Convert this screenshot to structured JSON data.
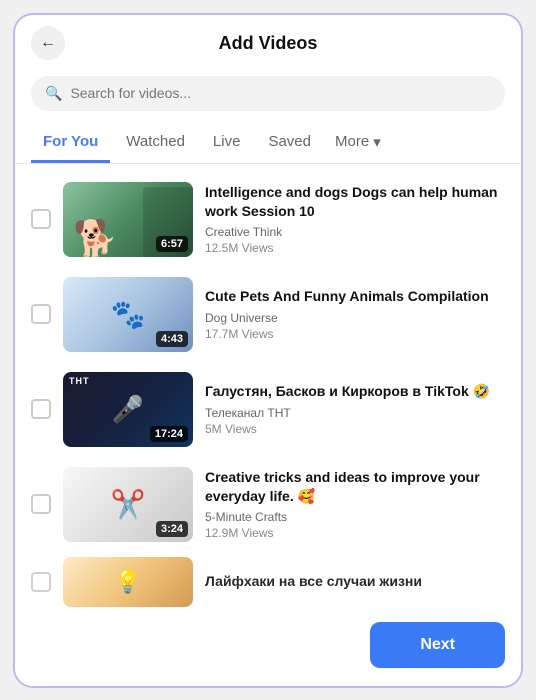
{
  "header": {
    "title": "Add Videos",
    "back_label": "←"
  },
  "search": {
    "placeholder": "Search for videos..."
  },
  "tabs": [
    {
      "id": "for-you",
      "label": "For You",
      "active": true
    },
    {
      "id": "watched",
      "label": "Watched",
      "active": false
    },
    {
      "id": "live",
      "label": "Live",
      "active": false
    },
    {
      "id": "saved",
      "label": "Saved",
      "active": false
    },
    {
      "id": "more",
      "label": "More",
      "active": false
    }
  ],
  "videos": [
    {
      "id": 1,
      "title": "Intelligence and dogs Dogs can help human work Session 10",
      "channel": "Creative Think",
      "views": "12.5M Views",
      "duration": "6:57",
      "thumb_class": "thumb-1",
      "emoji": "🐕"
    },
    {
      "id": 2,
      "title": "Cute Pets And Funny Animals Compilation",
      "channel": "Dog Universe",
      "views": "17.7M Views",
      "duration": "4:43",
      "thumb_class": "thumb-2",
      "emoji": "🐾"
    },
    {
      "id": 3,
      "title": "Галустян, Басков и Киркоров в TikTok 🤣",
      "channel": "Телеканал ТНТ",
      "views": "5M Views",
      "duration": "17:24",
      "thumb_class": "thumb-3",
      "emoji": "🎤"
    },
    {
      "id": 4,
      "title": "Creative tricks and ideas to improve your everyday life. 🥰",
      "channel": "5-Minute Crafts",
      "views": "12.9M Views",
      "duration": "3:24",
      "thumb_class": "thumb-4",
      "emoji": "✂️"
    },
    {
      "id": 5,
      "title": "Лайфхаки на все случаи жизни",
      "channel": "",
      "views": "",
      "duration": "",
      "thumb_class": "thumb-5",
      "emoji": "💡"
    }
  ],
  "footer": {
    "next_label": "Next"
  }
}
